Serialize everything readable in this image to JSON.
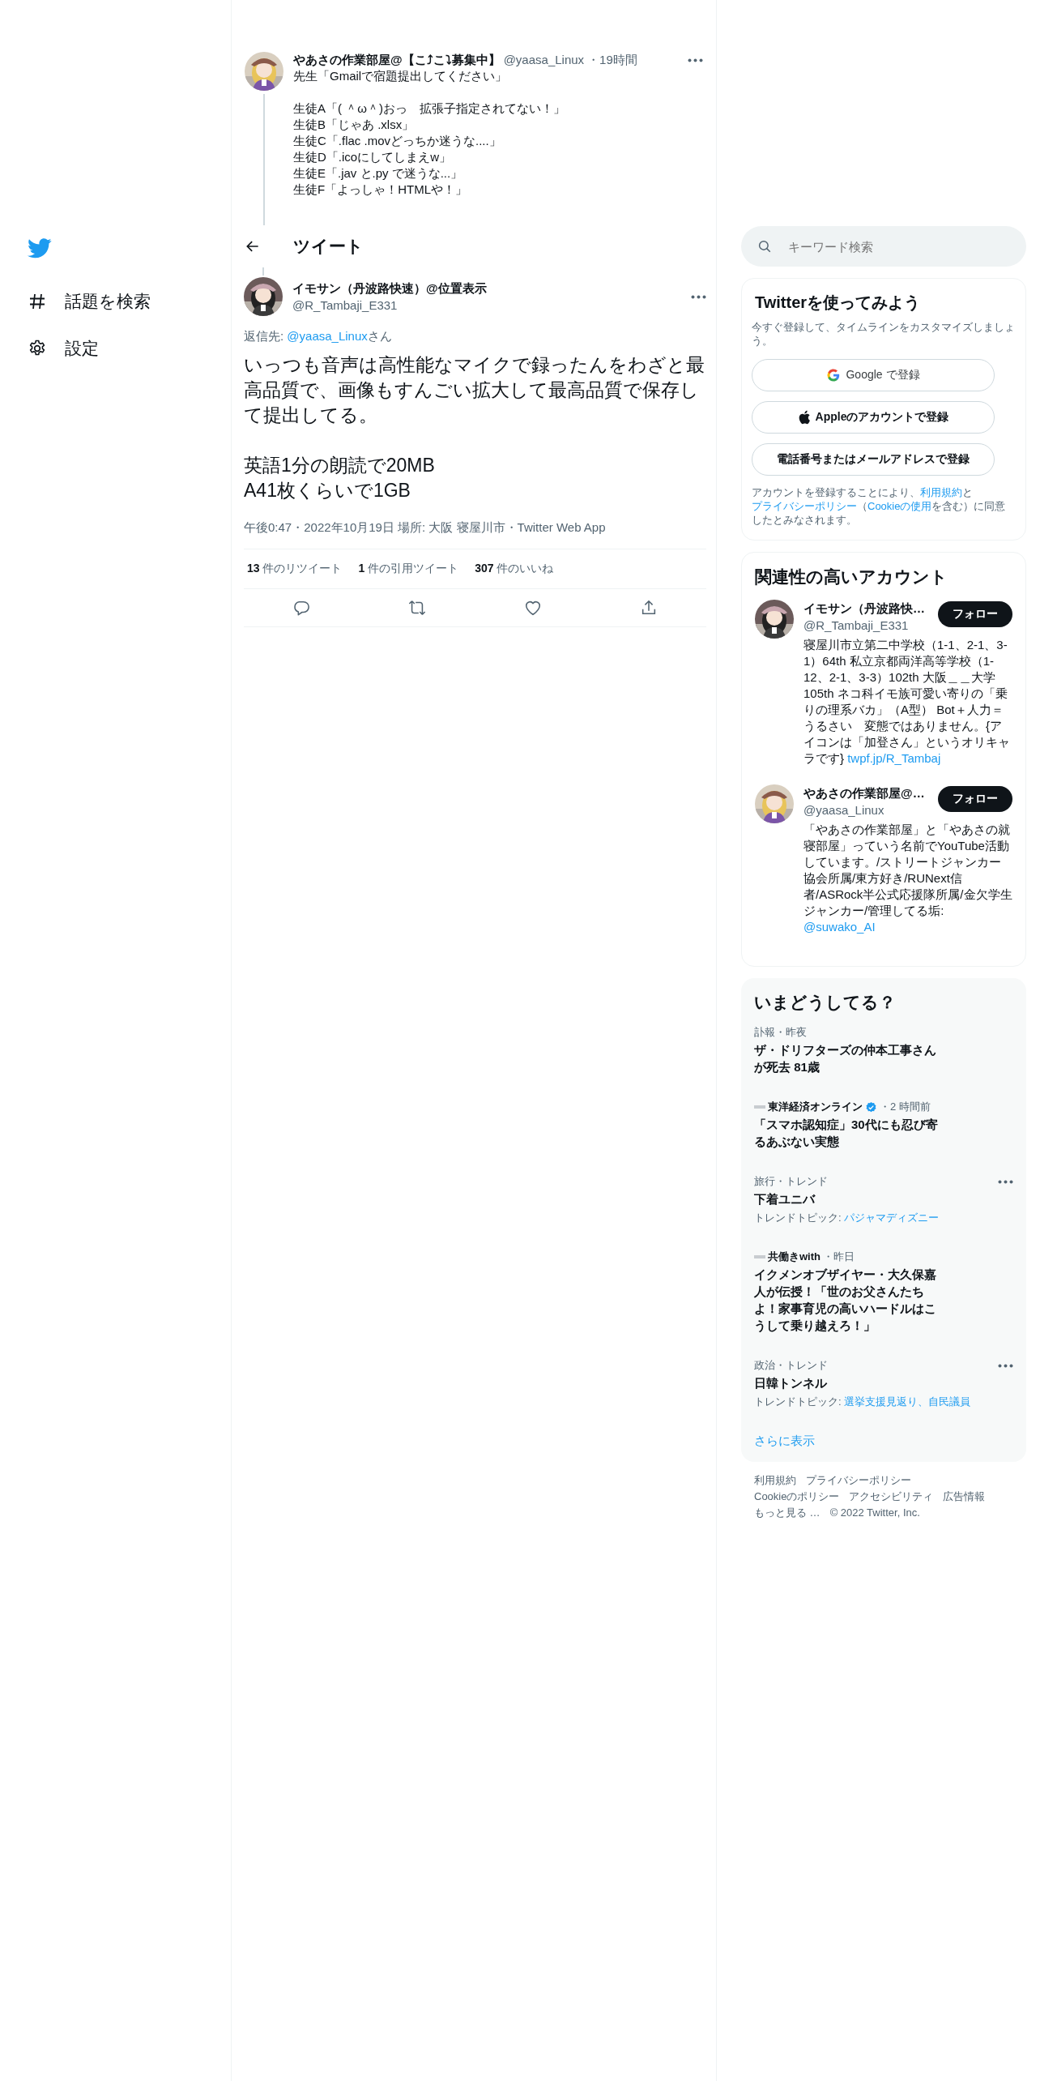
{
  "sidebar": {
    "items": [
      {
        "kind": "explore",
        "label": "話題を検索"
      },
      {
        "kind": "settings",
        "label": "設定"
      }
    ]
  },
  "parent_tweet": {
    "name": "やあさの作業部屋@【こ⤴こ⤵募集中】",
    "handle": "@yaasa_Linux",
    "time": "・19時間",
    "paragraphs": [
      [
        "先生「Gmailで宿題提出してください」"
      ],
      [
        "生徒A「( ＾ω＾)おっ　拡張子指定されてない！」",
        "生徒B「じゃあ .xlsx」",
        "生徒C「.flac .movどっちか迷うな....」",
        "生徒D「.icoにしてしまえw」",
        "生徒E「.jav と.py で迷うな...」",
        "生徒F「よっしゃ！HTMLや！」"
      ]
    ]
  },
  "header": {
    "title": "ツイート"
  },
  "tweet": {
    "name": "イモサン（丹波路快速）@位置表示",
    "handle": "@R_Tambaji_E331",
    "reply_to": {
      "prefix": "返信先: ",
      "handle": "@yaasa_Linux",
      "suffix": "さん"
    },
    "paragraphs": [
      [
        "いっつも音声は高性能なマイクで録ったんをわざと最高品質で、画像もすんごい拡大して最高品質で保存して提出してる。"
      ],
      [
        "英語1分の朗読で20MB",
        "A41枚くらいで1GB"
      ]
    ],
    "meta": "午後0:47・2022年10月19日 場所: 大阪 寝屋川市・Twitter Web App",
    "stats": [
      {
        "count": "13",
        "label": "件のリツイート"
      },
      {
        "count": "1",
        "label": "件の引用ツイート"
      },
      {
        "count": "307",
        "label": "件のいいね"
      }
    ],
    "actions": [
      {
        "kind": "reply"
      },
      {
        "kind": "retweet"
      },
      {
        "kind": "like"
      },
      {
        "kind": "share"
      }
    ]
  },
  "search": {
    "placeholder": "キーワード検索"
  },
  "signup": {
    "title": "Twitterを使ってみよう",
    "subtitle": "今すぐ登録して、タイムラインをカスタマイズしましょう。",
    "buttons": [
      {
        "kind": "google",
        "label": "Google で登録"
      },
      {
        "kind": "apple",
        "label": "Appleのアカウントで登録"
      },
      {
        "kind": "plain",
        "label": "電話番号またはメールアドレスで登録"
      }
    ],
    "legal": [
      {
        "text": "アカウントを登録することにより、",
        "link": false
      },
      {
        "text": "利用規約",
        "link": true
      },
      {
        "text": "と",
        "link": false
      },
      {
        "text": "プライバシーポリシー",
        "link": true
      },
      {
        "text": "（",
        "link": false
      },
      {
        "text": "Cookieの使用",
        "link": true
      },
      {
        "text": "を含む）に同意したとみなされます。",
        "link": false
      }
    ]
  },
  "who_to_follow": {
    "title": "関連性の高いアカウント",
    "accounts": [
      {
        "name": "イモサン（丹波路快…",
        "handle": "@R_Tambaji_E331",
        "button": "フォロー",
        "bio": [
          {
            "text": "寝屋川市立第二中学校（1-1、2-1、3-1）64th 私立京都両洋高等学校（1-12、2-1、3-3）102th 大阪＿＿大学 105th ネコ科イモ族可愛い寄りの「乗りの理系バカ」（A型） Bot＋人力＝うるさい　変態ではありません。{アイコンは「加登さん」というオリキャラです} ",
            "link": false
          },
          {
            "text": "twpf.jp/R_Tambaj",
            "link": true
          }
        ]
      },
      {
        "name": "やあさの作業部屋@…",
        "handle": "@yaasa_Linux",
        "button": "フォロー",
        "bio": [
          {
            "text": "「やあさの作業部屋」と「やあさの就寝部屋」っていう名前でYouTube活動しています。/ストリートジャンカー協会所属/東方好き/RUNext信者/ASRock半公式応援隊所属/金欠学生ジャンカー/管理してる垢: ",
            "link": false
          },
          {
            "text": "@suwako_AI",
            "link": true
          }
        ]
      }
    ]
  },
  "trends": {
    "title": "いまどうしてる？",
    "more": "さらに表示",
    "items": [
      {
        "kind": "news",
        "context": "訃報・昨夜",
        "headline": "ザ・ドリフターズの仲本工事さんが死去 81歳"
      },
      {
        "kind": "source",
        "source": "東洋経済オンライン",
        "verified": true,
        "time": "・2 時間前",
        "headline": "「スマホ認知症」30代にも忍び寄るあぶない実態"
      },
      {
        "kind": "trend",
        "context": "旅行・トレンド",
        "headline": "下着ユニバ",
        "topic_label": "トレンドトピック: ",
        "topics": "パジャマディズニー"
      },
      {
        "kind": "source",
        "source": "共働きwith",
        "verified": false,
        "time": "・昨日",
        "headline": "イクメンオブザイヤー・大久保嘉人が伝授！「世のお父さんたちよ！家事育児の高いハードルはこうして乗り越えろ！」"
      },
      {
        "kind": "trend",
        "context": "政治・トレンド",
        "headline": "日韓トンネル",
        "topic_label": "トレンドトピック: ",
        "topics": "選挙支援見返り、自民議員"
      }
    ]
  },
  "footer": {
    "links": [
      "利用規約",
      "プライバシーポリシー",
      "Cookieのポリシー",
      "アクセシビリティ",
      "広告情報",
      "もっと見る …"
    ],
    "copyright": "© 2022 Twitter, Inc."
  }
}
